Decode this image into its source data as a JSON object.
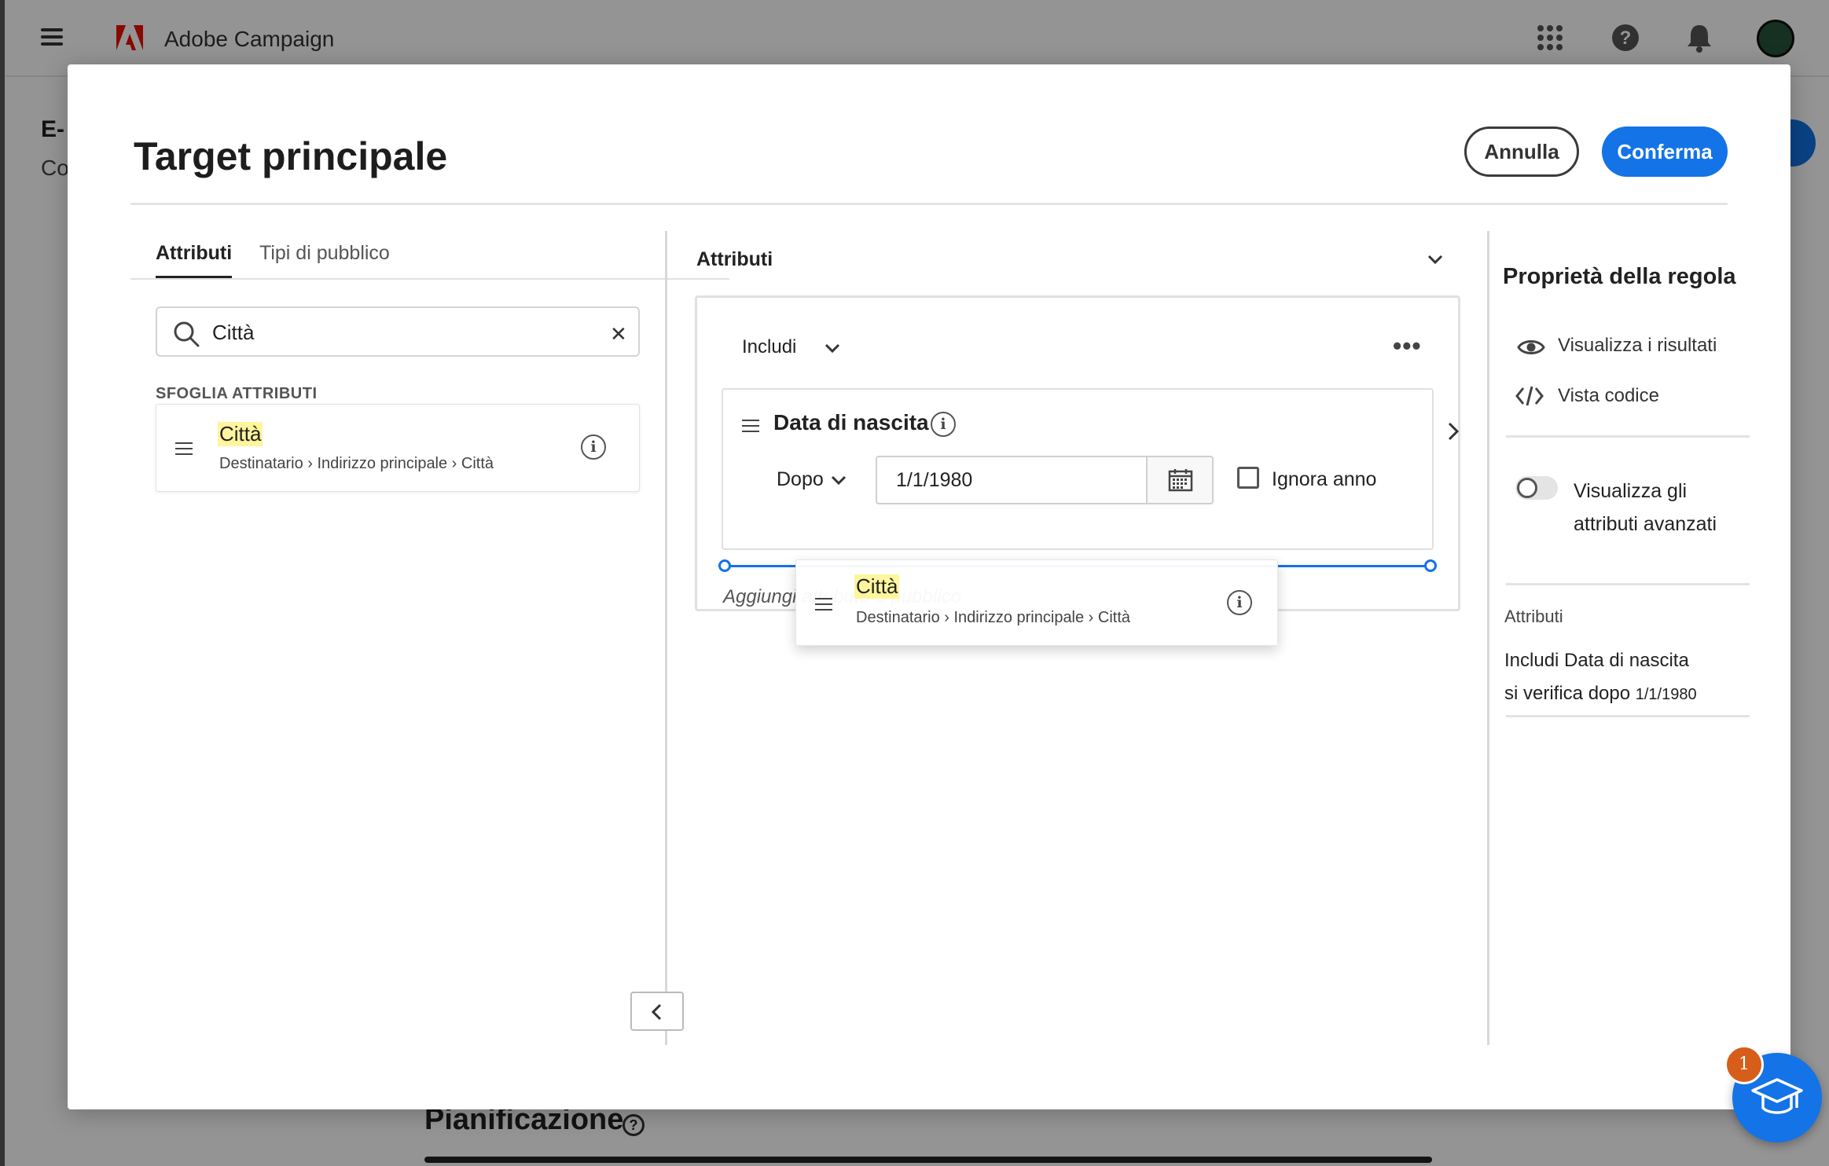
{
  "app": {
    "title": "Adobe Campaign",
    "page_title_partial": "E-",
    "page_sub_partial": "Co",
    "section_title": "Pianificazione"
  },
  "modal": {
    "title": "Target principale",
    "cancel_label": "Annulla",
    "confirm_label": "Conferma"
  },
  "left_panel": {
    "tabs": [
      {
        "label": "Attributi",
        "active": true
      },
      {
        "label": "Tipi di pubblico",
        "active": false
      }
    ],
    "search": {
      "value": "Città",
      "icon": "search-icon",
      "clear_icon": "close-icon"
    },
    "section_label": "SFOGLIA ATTRIBUTI",
    "attribute": {
      "name": "Città",
      "path": "Destinatario › Indirizzo principale › Città"
    }
  },
  "middle_panel": {
    "header": "Attributi",
    "include_label": "Includi",
    "rule": {
      "title": "Data di nascita",
      "operator": "Dopo",
      "date_value": "1/1/1980",
      "checkbox_label": "Ignora anno",
      "checkbox_checked": false
    },
    "add_hint": "Aggiungi attributo o pubblico",
    "drag_item": {
      "name": "Città",
      "path": "Destinatario › Indirizzo principale › Città"
    }
  },
  "right_panel": {
    "title": "Proprietà della regola",
    "actions": [
      {
        "label": "Visualizza i risultati",
        "icon": "eye-icon"
      },
      {
        "label": "Vista codice",
        "icon": "code-icon"
      }
    ],
    "toggle_label": "Visualizza gli attributi avanzati",
    "toggle_on": false,
    "attr_label": "Attributi",
    "summary_line1": "Includi Data di nascita",
    "summary_line2": "si verifica dopo",
    "summary_date": "1/1/1980"
  },
  "learn": {
    "badge": "1",
    "icon": "graduation-cap-icon"
  },
  "colors": {
    "accent": "#1473e6",
    "highlight": "#fff59d",
    "badge": "#d65d1a",
    "brand_red": "#eb1000"
  }
}
